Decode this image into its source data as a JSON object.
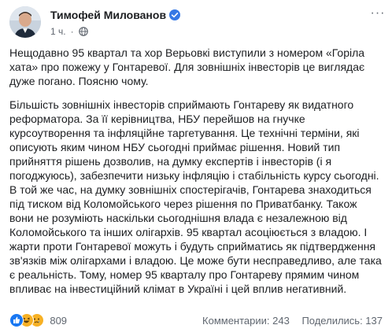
{
  "post": {
    "author": "Тимофей Милованов",
    "time": "1 ч.",
    "separator": "·",
    "more_label": "···",
    "paragraphs": [
      "Нещодавно 95 квартал та хор Верьовкі виступили з номером «Горіла хата» про пожежу у Гонтаревої. Для зовнішніх інвесторів це виглядає дуже погано. Поясню чому.",
      "Більшість зовнішніх інвесторів сприймають Гонтареву як видатного реформатора. За її керівництва, НБУ перейшов на гнучке курсоутворення та інфляційне таргетування. Це технічні терміни, які описують яким чином НБУ сьогодні приймає рішення. Новий тип прийняття рішень дозволив, на думку експертів і інвесторів (і я погоджуюсь), забезпечити низьку інфляцію і стабільність курсу сьогодні. В той же час, на думку зовнішніх спостерігачів, Гонтарева знаходиться під тиском від Коломойського через рішення по Приватбанку. Також вони не розуміють наскільки сьогоднішня влада є незалежною від Коломойського та інших олігархів. 95 квартал асоціюється з владою. І жарти проти Гонтаревої можуть і будуть сприйматись як підтвердження зв'язків між олігархами і владою. Це може бути несправедливо, але така є реальність. Тому, номер 95 кварталу про Гонтареву прямим чином впливає на інвестиційний клімат в Україні і цей вплив негативний."
    ]
  },
  "footer": {
    "reaction_count": "809",
    "comments": "Комментарии: 243",
    "shares": "Поделились: 137"
  },
  "colors": {
    "text": "#1c1e21",
    "meta": "#616770",
    "verified": "#3578e5",
    "like": "#1877f2",
    "haha": "#f7b125"
  },
  "icons": [
    "verified-badge-icon",
    "globe-icon",
    "more-options-icon",
    "like-reaction-icon",
    "haha-reaction-icon",
    "sad-reaction-icon"
  ]
}
